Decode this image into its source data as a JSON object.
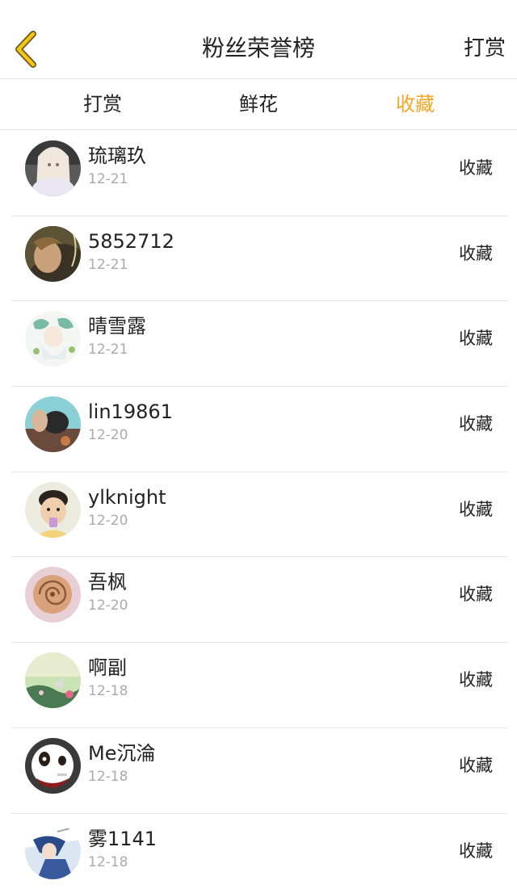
{
  "navbar": {
    "title": "粉丝荣誉榜",
    "action_label": "打赏",
    "back_icon": "chevron-left-icon",
    "accent_color": "#f5a623"
  },
  "tabs": [
    {
      "label": "打赏",
      "active": false
    },
    {
      "label": "鲜花",
      "active": false
    },
    {
      "label": "收藏",
      "active": true
    }
  ],
  "fans": [
    {
      "name": "琉璃玖",
      "date": "12-21",
      "action": "收藏"
    },
    {
      "name": "5852712",
      "date": "12-21",
      "action": "收藏"
    },
    {
      "name": "晴雪露",
      "date": "12-21",
      "action": "收藏"
    },
    {
      "name": "lin19861",
      "date": "12-20",
      "action": "收藏"
    },
    {
      "name": "ylknight",
      "date": "12-20",
      "action": "收藏"
    },
    {
      "name": "吾枫",
      "date": "12-20",
      "action": "收藏"
    },
    {
      "name": "啊副",
      "date": "12-18",
      "action": "收藏"
    },
    {
      "name": "Me沉淪",
      "date": "12-18",
      "action": "收藏"
    },
    {
      "name": "雾1141",
      "date": "12-18",
      "action": "收藏"
    }
  ]
}
